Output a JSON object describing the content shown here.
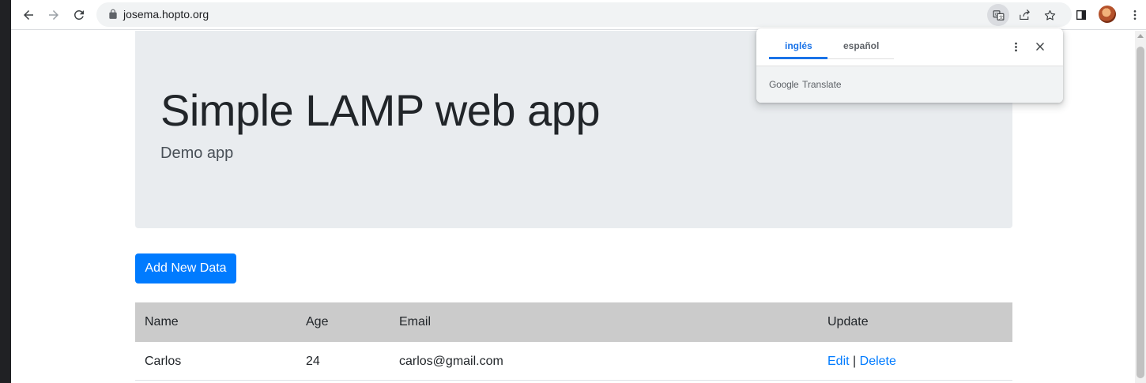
{
  "browser": {
    "url": "josema.hopto.org"
  },
  "translate_popup": {
    "tabs": [
      {
        "label": "inglés",
        "active": true
      },
      {
        "label": "español",
        "active": false
      }
    ],
    "footer_brand": "Google",
    "footer_product": "Translate"
  },
  "jumbotron": {
    "title": "Simple LAMP web app",
    "subtitle": "Demo app"
  },
  "actions": {
    "add_label": "Add New Data"
  },
  "table": {
    "headers": [
      "Name",
      "Age",
      "Email",
      "Update"
    ],
    "rows": [
      {
        "name": "Carlos",
        "age": "24",
        "email": "carlos@gmail.com",
        "edit": "Edit",
        "separator": "|",
        "delete": "Delete"
      }
    ]
  },
  "colors": {
    "primary": "#007bff",
    "jumbotron_bg": "#e9ecef",
    "table_header_bg": "#cbcbcb",
    "translate_accent": "#1a73e8"
  },
  "icons": [
    "back-icon",
    "forward-icon",
    "reload-icon",
    "lock-icon",
    "translate-icon",
    "share-icon",
    "star-icon",
    "side-panel-icon",
    "profile-avatar",
    "more-vert-icon",
    "close-icon"
  ]
}
